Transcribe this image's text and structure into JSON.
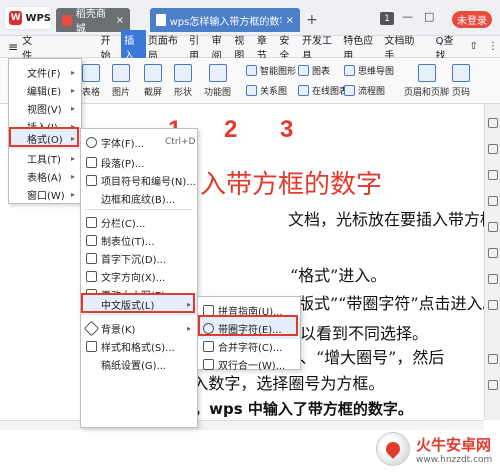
{
  "titlebar": {
    "app_name": "WPS",
    "tabs": [
      {
        "label": "稻壳商城",
        "close": "×"
      },
      {
        "label": "wps怎样输入带方框的数字.docx",
        "close": "×"
      }
    ],
    "new_tab": "+",
    "window_count": "1",
    "minimize": "—",
    "maximize": "□",
    "login_label": "未登录"
  },
  "menubar": {
    "hamburger": "≡",
    "file_label": "文件",
    "items": [
      "开始",
      "插入",
      "页面布局",
      "引用",
      "审阅",
      "视图",
      "章节",
      "安全",
      "开发工具",
      "特色应用",
      "文档助手"
    ],
    "active": "插入",
    "search_label": "Q查找",
    "share": "⇧",
    "more": "⋮"
  },
  "ribbon": {
    "groups": [
      "表格",
      "图片",
      "截屏",
      "形状",
      "功能图",
      "关系图",
      "在线图表",
      "流程图",
      "页眉和页脚",
      "页码"
    ],
    "small_items": [
      "智能图形",
      "图表",
      "思维导图"
    ]
  },
  "file_menu": {
    "items": [
      {
        "label": "文件(F)",
        "arrow": "▸"
      },
      {
        "label": "编辑(E)",
        "arrow": "▸"
      },
      {
        "label": "视图(V)",
        "arrow": "▸"
      },
      {
        "label": "插入(I)",
        "arrow": "▸"
      },
      {
        "label": "格式(O)",
        "arrow": "▸"
      },
      {
        "label": "工具(T)",
        "arrow": "▸"
      },
      {
        "label": "表格(A)",
        "arrow": "▸"
      },
      {
        "label": "窗口(W)",
        "arrow": "▸"
      }
    ]
  },
  "format_menu": {
    "items": [
      {
        "label": "字体(F)...",
        "shortcut": "Ctrl+D"
      },
      {
        "label": "段落(P)..."
      },
      {
        "label": "项目符号和编号(N)..."
      },
      {
        "label": "边框和底纹(B)..."
      },
      {
        "label": "分栏(C)..."
      },
      {
        "label": "制表位(T)..."
      },
      {
        "label": "首字下沉(D)..."
      },
      {
        "label": "文字方向(X)..."
      },
      {
        "label": "更改大小写(E)..."
      },
      {
        "label": "中文版式(L)",
        "arrow": "▸"
      },
      {
        "label": "背景(K)",
        "arrow": "▸"
      },
      {
        "label": "样式和格式(S)..."
      },
      {
        "label": "稿纸设置(G)..."
      }
    ]
  },
  "chinese_menu": {
    "items": [
      {
        "label": "拼音指南(U)..."
      },
      {
        "label": "带圈字符(E)..."
      },
      {
        "label": "合并字符(C)..."
      },
      {
        "label": "双行合一(W)..."
      }
    ]
  },
  "step_numbers": [
    "1",
    "2",
    "3"
  ],
  "document": {
    "title_fragment": "入带方框的数字",
    "lines": [
      "文档，光标放在要插入带方框",
      "“格式”进入。",
      "版式”“带圈字符”点击进入。",
      "以看到不同选择。",
      "、“增大圈号”，然后",
      "在“文字”处输入数字，选择圈号为方框。",
      "6 点击【确定】，wps 中输入了带方框的数字。"
    ]
  },
  "watermark": {
    "name": "火牛安卓网",
    "url": "www.hnzzdt.com"
  }
}
